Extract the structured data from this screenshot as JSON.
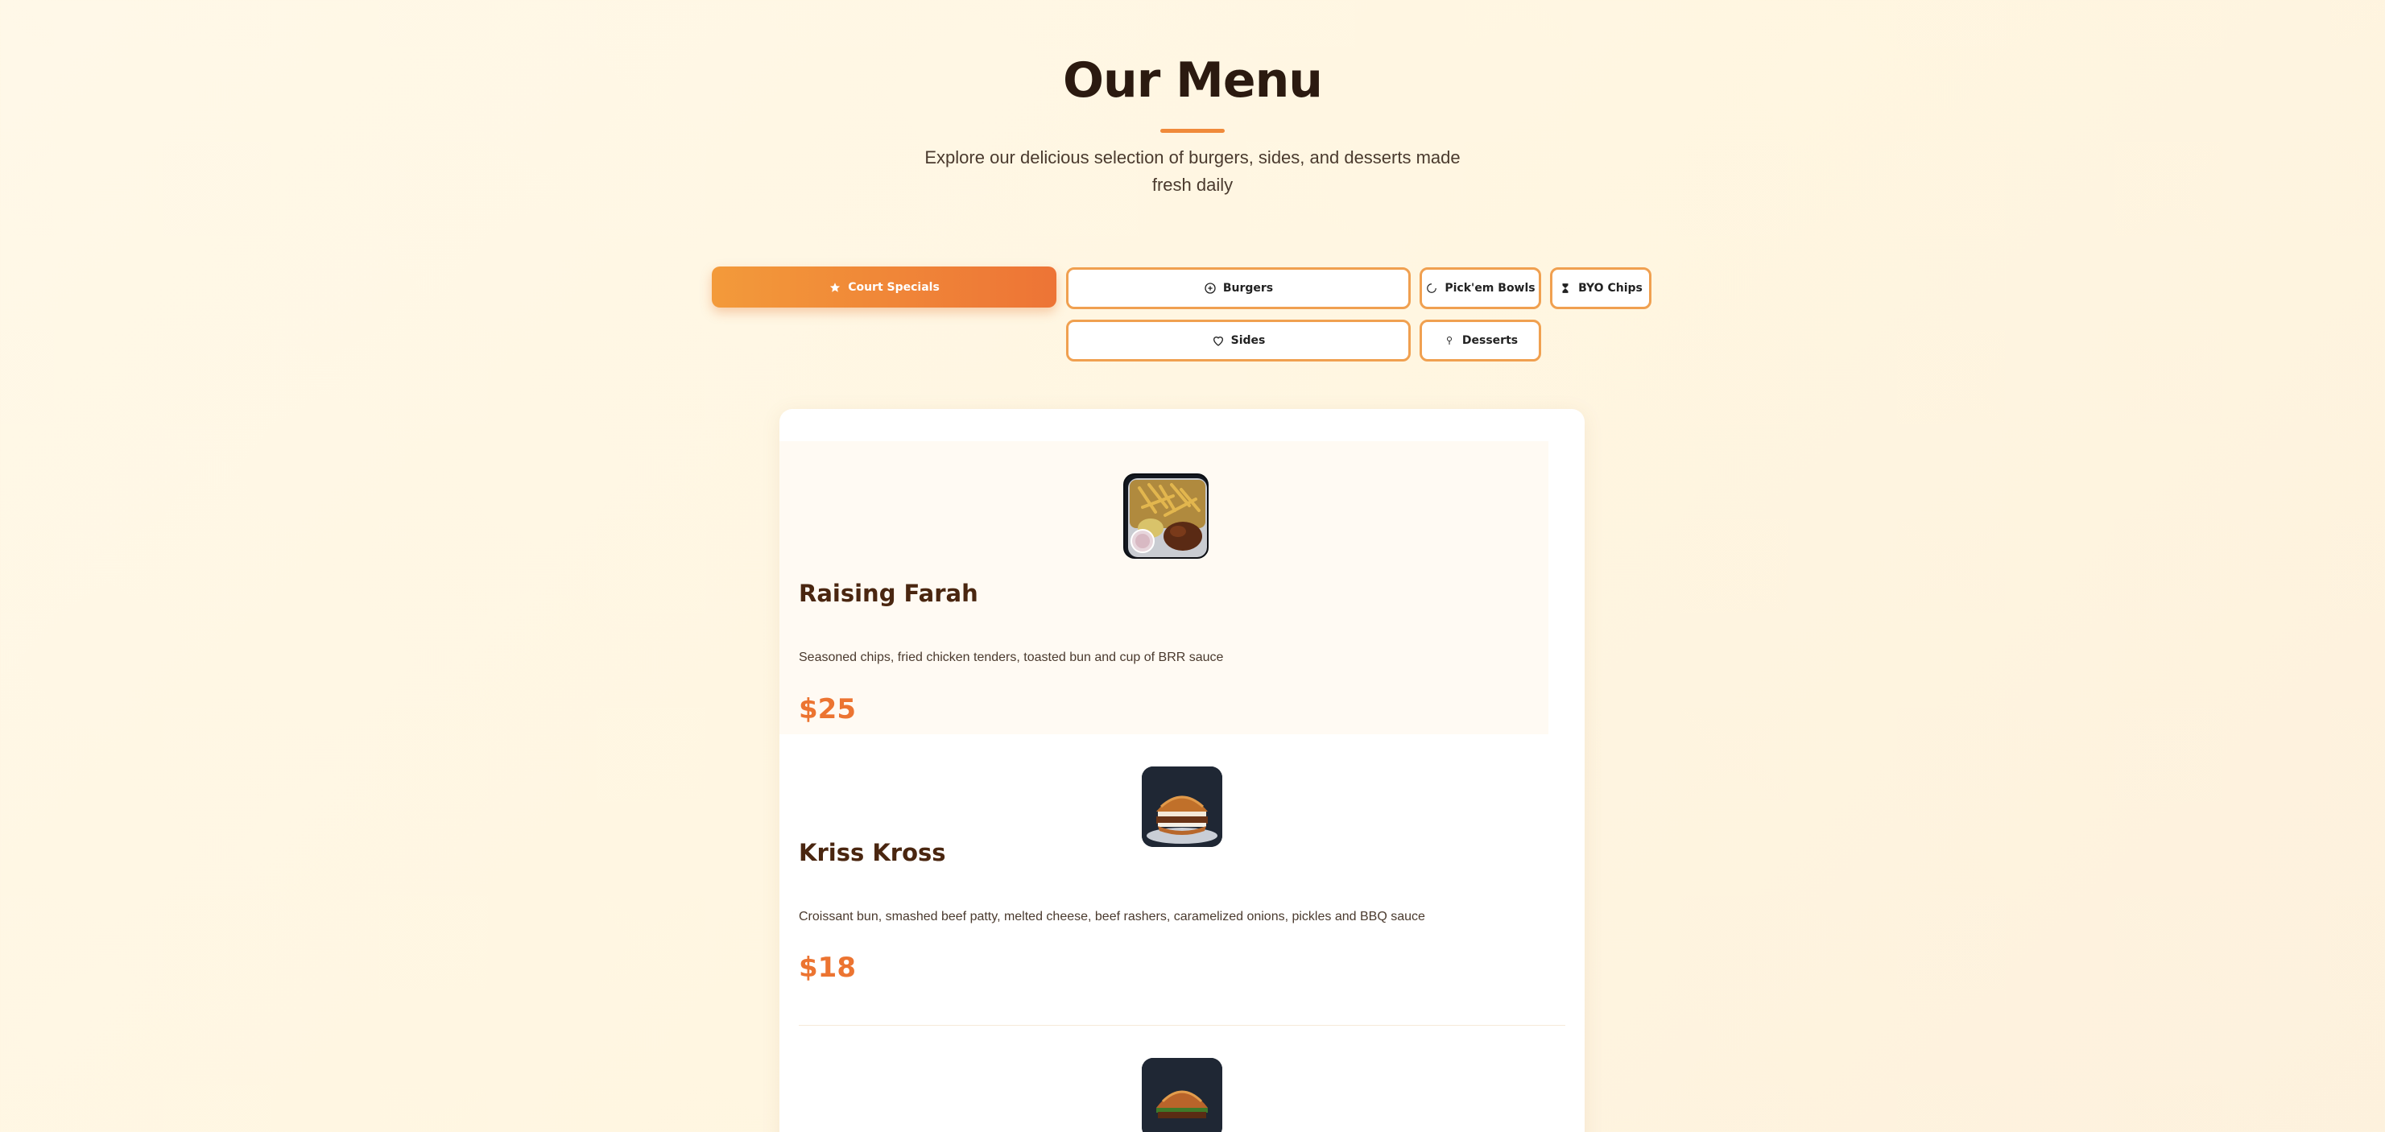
{
  "header": {
    "title": "Our Menu",
    "subtitle": "Explore our delicious selection of burgers, sides, and desserts made fresh daily"
  },
  "tabs": [
    {
      "label": "Court Specials",
      "icon": "star-icon",
      "active": true
    },
    {
      "label": "Burgers",
      "icon": "circle-plus-icon",
      "active": false
    },
    {
      "label": "Pick'em Bowls",
      "icon": "bowl-icon",
      "active": false
    },
    {
      "label": "BYO Chips",
      "icon": "hourglass-icon",
      "active": false
    },
    {
      "label": "Sides",
      "icon": "heart-icon",
      "active": false
    },
    {
      "label": "Desserts",
      "icon": "ice-cream-icon",
      "active": false
    }
  ],
  "items": [
    {
      "name": "Raising Farah",
      "description": "Seasoned chips, fried chicken tenders, toasted bun and cup of BRR sauce",
      "price": "$25",
      "image": "chicken-tenders-chips-box"
    },
    {
      "name": "Kriss Kross",
      "description": "Croissant bun, smashed beef patty, melted cheese, beef rashers, caramelized onions, pickles and BBQ sauce",
      "price": "$18",
      "image": "croissant-burger"
    },
    {
      "name": "",
      "description": "",
      "price": "",
      "image": "croissant-burger-2"
    }
  ],
  "colors": {
    "accent": "#ec7431",
    "accent_light": "#f39a3a",
    "title": "#2b1a10",
    "item_name": "#4a2610",
    "background": "#fff7e6"
  }
}
